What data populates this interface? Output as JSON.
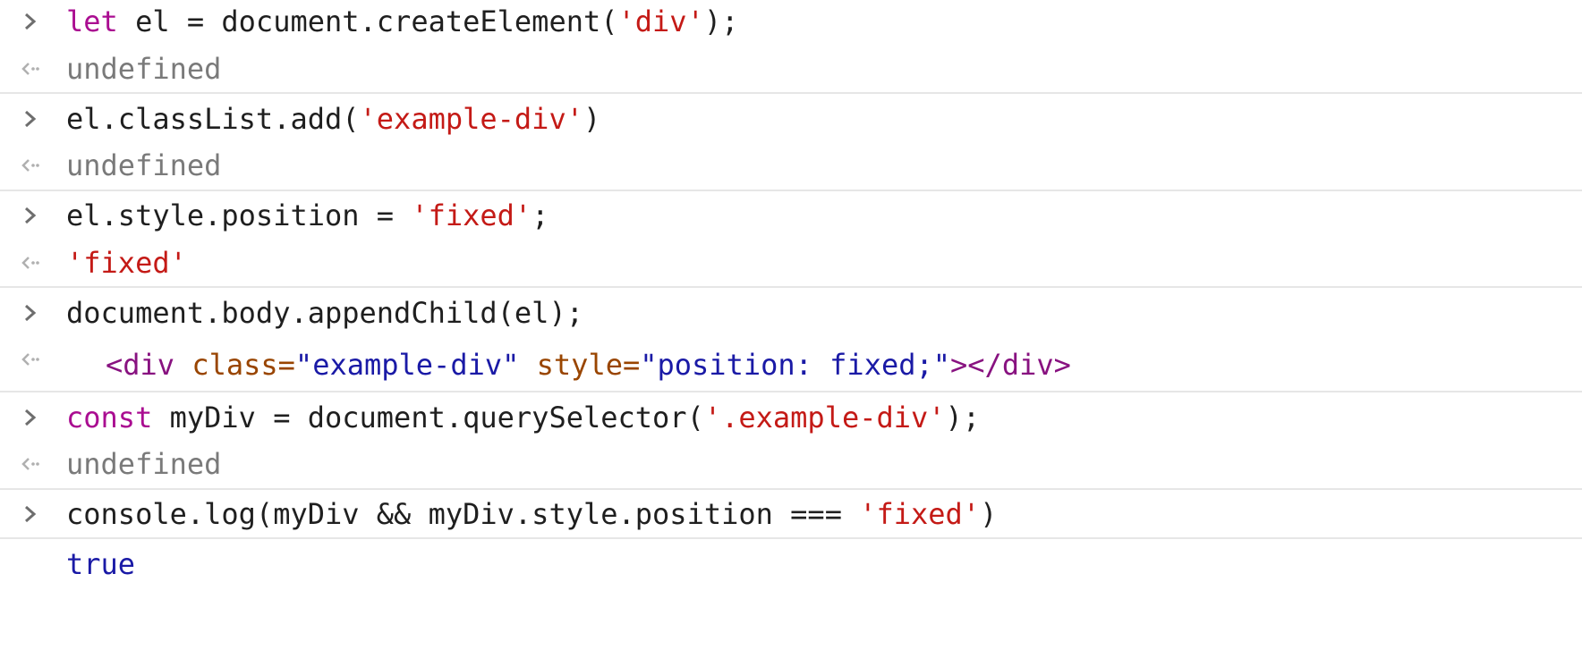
{
  "colors": {
    "keyword": "#aa0d91",
    "string": "#c41a16",
    "plain": "#1f1f1f",
    "undefined": "#7a7a7a",
    "html_tag": "#881280",
    "html_attr": "#994500",
    "html_attr_value": "#1a1aa6",
    "boolean": "#1a1aa6",
    "separator": "#e6e6e6",
    "chevron": "#6e6e6e"
  },
  "icons": {
    "input": "chevron-right-icon",
    "output": "return-arrow-icon"
  },
  "entries": [
    {
      "input": {
        "kw": "let",
        "a": " el = document.createElement(",
        "s": "'div'",
        "b": ");"
      },
      "output": "undefined"
    },
    {
      "input": {
        "a": "el.classList.add(",
        "s": "'example-div'",
        "b": ")"
      },
      "output": "undefined"
    },
    {
      "input": {
        "a": "el.style.position = ",
        "s": "'fixed'",
        "b": ";"
      },
      "output": "'fixed'"
    },
    {
      "input": {
        "a": "document.body.appendChild(el);"
      },
      "output": {
        "open": "<div",
        "attr1_name": " class=",
        "attr1_value": "\"example-div\"",
        "attr2_name": " style=",
        "attr2_value": "\"position: fixed;\"",
        "close": "></div>"
      }
    },
    {
      "input": {
        "kw": "const",
        "a": " myDiv = document.querySelector(",
        "s": "'.example-div'",
        "b": ");"
      },
      "output": "undefined"
    },
    {
      "input": {
        "a": "console.log(myDiv && myDiv.style.position === ",
        "s": "'fixed'",
        "b": ")"
      },
      "output": "true"
    }
  ]
}
